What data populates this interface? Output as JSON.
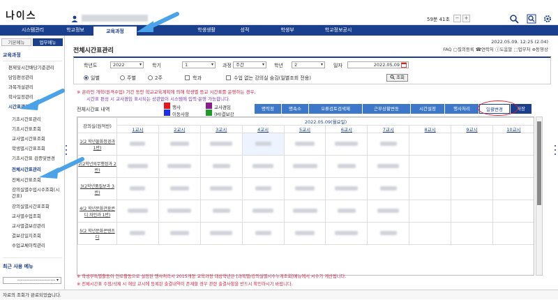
{
  "header": {
    "logo": "나이스",
    "timer": "59분 41초",
    "timer_minus": "−",
    "timer_plus": "+"
  },
  "nav": {
    "items": [
      "시스템관리",
      "학교정보",
      "교육과정",
      "",
      "학생생활",
      "성적",
      "학생부",
      "학교정보공시"
    ]
  },
  "sidebar": {
    "tabs": [
      "기본메뉴",
      "업무메뉴"
    ],
    "section": "교육과정",
    "items": [
      {
        "label": "편제및시간배당기준관리",
        "sub": false
      },
      {
        "label": "담임편성관리",
        "sub": false
      },
      {
        "label": "과목개설관리",
        "sub": false
      },
      {
        "label": "학사일정관리",
        "sub": false
      },
      {
        "label": "시간표관리",
        "sub": false,
        "hl": true
      },
      {
        "label": "기초시간표관리",
        "sub": true
      },
      {
        "label": "기초시간표조회",
        "sub": true
      },
      {
        "label": "교사별시간표조회",
        "sub": true
      },
      {
        "label": "학생별시간표조회",
        "sub": true
      },
      {
        "label": "기초시간표 검증및변경",
        "sub": true
      },
      {
        "label": "전체시간표관리",
        "sub": true,
        "hl": true
      },
      {
        "label": "전체시간표조회",
        "sub": true
      },
      {
        "label": "강의실별수업시수조회(시",
        "sub": true
      },
      {
        "label": "간표)",
        "sub": true
      },
      {
        "label": "강의실별시간표조회",
        "sub": true
      },
      {
        "label": "교사별수업조회",
        "sub": true
      },
      {
        "label": "교사별결보강관리",
        "sub": true
      },
      {
        "label": "결보강일지조회",
        "sub": true
      },
      {
        "label": "수업교체이력관리",
        "sub": true
      }
    ],
    "recent_title": "최근 사용 메뉴",
    "recent_select": "-------------------------  ▾"
  },
  "page": {
    "title": "전체시간표관리",
    "datetime": "2022.05.09. 12:25 (2.04)",
    "links": "FAQ  ▢질의등록  ☎연락처  ⓘ도움말  ⬚업무처  ⊕동영상"
  },
  "filter": {
    "year_label": "학년도",
    "year_value": "2022",
    "term_label": "학기",
    "term_value": "1",
    "course_label": "과정",
    "course_value": "주간",
    "grade_label": "학년",
    "grade_value": "2",
    "date_label": "일자",
    "date_value": "2022.05.09",
    "radio_day": "일별",
    "radio_week": "주별",
    "radio_2week": "2주",
    "check_class": "학과",
    "check_exclude": "수업 없는 강의실 숨김(일별조회 전용)",
    "search_label": "조회"
  },
  "notices": [
    "※ 온라인 개학(원격수업) 기간 동안 학교교육계획에 의해 학생별 등교 시간표를 운영하는 경우,",
    "시간표 편성 시 교사겸임 표시되는 상관없이 시스템에 입력·운영 가능합니다."
  ],
  "legend": {
    "title": "전체시간표 내역",
    "items": [
      {
        "label": "행사",
        "color": "#e8141b"
      },
      {
        "label": "교사겸임",
        "color": "#8b1a8b"
      },
      {
        "label": "이동사항",
        "color": "#1f2ee6"
      },
      {
        "label": "(M)결보강",
        "color": "#1d9a2a"
      }
    ]
  },
  "actions": [
    "명력정",
    "명속소",
    "오류검토검색제",
    "근무상황변동",
    "시간설정",
    "행사처리",
    "일괄변경",
    "저장"
  ],
  "table": {
    "date_header": "2022.05.09(월요일)",
    "room_header": "강의실(원적반)",
    "periods": [
      "1교시",
      "2교시",
      "3교시",
      "4교시",
      "5교시",
      "6교시",
      "7교시",
      "8교시",
      "9교시",
      "10교시"
    ],
    "rows": [
      {
        "room": "1(2 학년물화정경과 1반)"
      },
      {
        "room": "2(2학년의무행정과 2반)"
      },
      {
        "room": "3(2학년품질보과 3반)"
      },
      {
        "room": "4(2 학년문화관광콘디 자인과 1반)"
      },
      {
        "room": "5(2 학년문화콘텐츠디"
      }
    ]
  },
  "footnotes": [
    "※ 학생부특별활동이 진로활동으로 설정된 행사처리시 2015개정 교육과정 대상학년은 [과목별/강의실별시수누계조회]메뉴에서 시수가 계산됩니다.",
    "※ 전체시간표 수정/삭제 시 해당 교시에 등록된 출결내역이 존재할 경우 관련 출결사항을 반드시 확인하시기 바랍니다."
  ],
  "status": "자료의 조회가 완료되었습니다."
}
